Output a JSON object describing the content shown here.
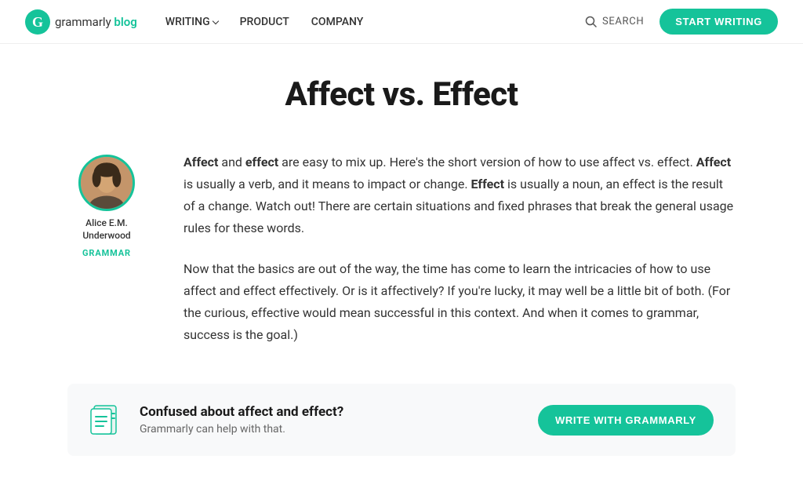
{
  "nav": {
    "logo_text": "grammarly",
    "logo_blog": "blog",
    "links": [
      {
        "label": "WRITING",
        "has_dropdown": true
      },
      {
        "label": "PRODUCT",
        "has_dropdown": false
      },
      {
        "label": "COMPANY",
        "has_dropdown": false
      }
    ],
    "search_label": "SEARCH",
    "start_writing_label": "START WRITING"
  },
  "article": {
    "title": "Affect vs. Effect",
    "author": {
      "name": "Alice E.M. Underwood",
      "category": "GRAMMAR"
    },
    "paragraphs": [
      {
        "html": "<b>Affect</b> and <b>effect</b> are easy to mix up. Here's the short version of how to use affect vs. effect. <b>Affect</b> is usually a verb, and it means to impact or change. <b>Effect</b> is usually a noun, an effect is the result of a change. Watch out! There are certain situations and fixed phrases that break the general usage rules for these words."
      },
      {
        "html": "Now that the basics are out of the way, the time has come to learn the intricacies of how to use affect and effect effectively. Or is it affectively? If you're lucky, it may well be a little bit of both. (For the curious, effective would mean successful in this context. And when it comes to grammar, success is the goal.)"
      }
    ]
  },
  "cta": {
    "title": "Confused about affect and effect?",
    "subtitle": "Grammarly can help with that.",
    "button_label": "WRITE WITH GRAMMARLY"
  }
}
